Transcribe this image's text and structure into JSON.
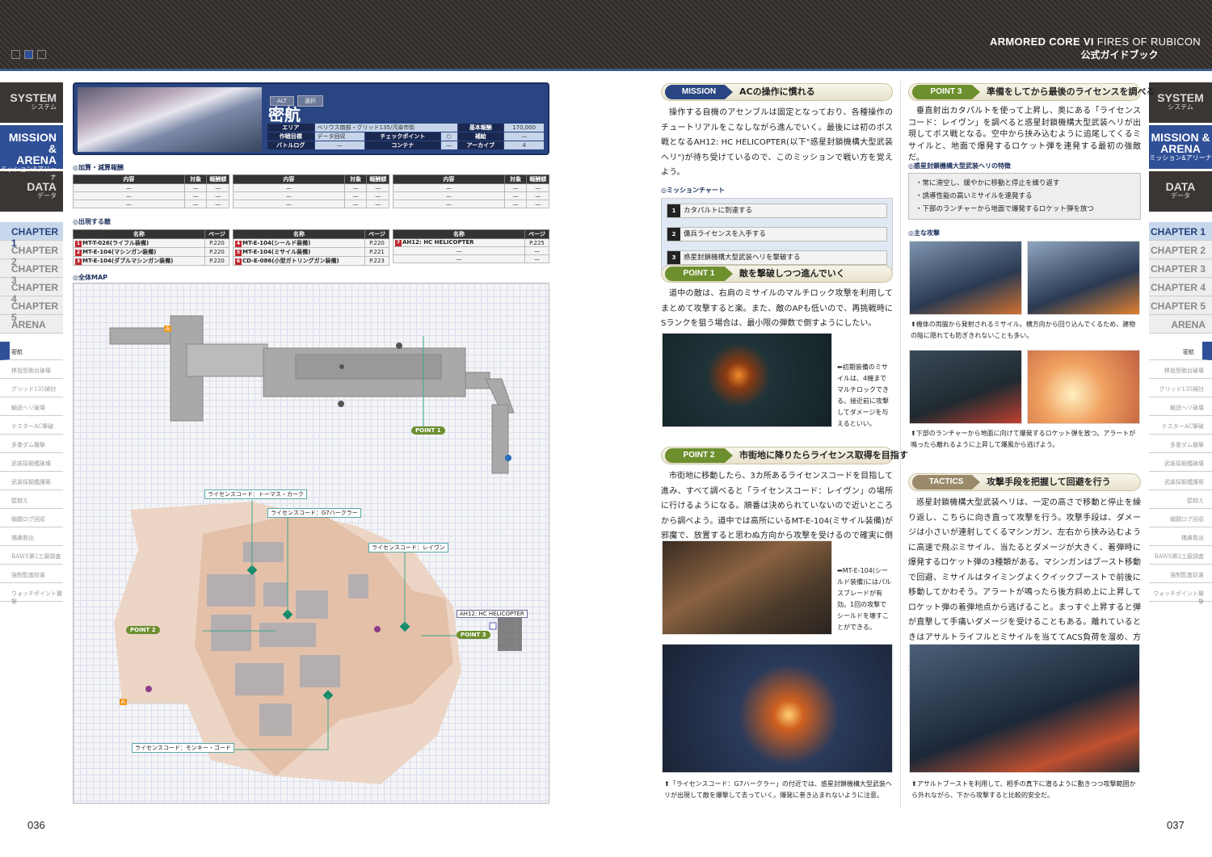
{
  "header": {
    "brand_bold": "ARMORED CORE VI",
    "brand_light": "FIRES OF RUBICON",
    "subtitle": "公式ガイドブック"
  },
  "colors": {
    "accent": "#2f4f97",
    "header_bg": "#3a3634",
    "point_green": "#6d8f2e",
    "enemy_red": "#c0262d"
  },
  "sidebar": {
    "tabs": [
      {
        "label": "SYSTEM",
        "sub": "システム"
      },
      {
        "label": "MISSION &",
        "label2": "ARENA",
        "sub": "ミッション&アリーナ"
      },
      {
        "label": "DATA",
        "sub": "データ"
      }
    ],
    "chapters": [
      "CHAPTER 1",
      "CHAPTER 2",
      "CHAPTER 3",
      "CHAPTER 4",
      "CHAPTER 5",
      "ARENA"
    ],
    "missions": [
      "密航",
      "移設型砲台破壊",
      "グリッド135掃討",
      "輸送ヘリ破壊",
      "テスターAC撃破",
      "多重ダム襲撃",
      "武装採掘艦破壊",
      "武装採掘艦護衛",
      "壁越え",
      "戦闘ログ回収",
      "捕虜救出",
      "BAWS第2工廠調査",
      "強制監査妨害",
      "ウォッチポイント襲撃"
    ]
  },
  "mission": {
    "tags": [
      "ALT",
      "選択"
    ],
    "title": "密航",
    "info": {
      "area_k": "エリア",
      "area_v": "ベリウス南部・グリッド135/汚染市街",
      "reward_k": "基本報酬",
      "reward_v": "170,000",
      "goal_k": "作戦目標",
      "goal_v": "データ回収",
      "cp_k": "チェックポイント",
      "cp_v": "○",
      "supply_k": "補給",
      "supply_v": "—",
      "log_k": "バトルログ",
      "log_v": "—",
      "cont_k": "コンテナ",
      "cont_v": "—",
      "arch_k": "アーカイブ",
      "arch_v": "4"
    }
  },
  "rewards": {
    "title": "加算・減算報酬",
    "headers": [
      "内容",
      "対象",
      "報酬額"
    ],
    "dash": "—"
  },
  "enemies": {
    "title": "出現する敵",
    "headers": [
      "名称",
      "ページ"
    ],
    "cols": [
      [
        {
          "n": "1",
          "name": "MT-T-026(ライフル装備)",
          "page": "P.220"
        },
        {
          "n": "2",
          "name": "MT-E-104(マシンガン装備)",
          "page": "P.220"
        },
        {
          "n": "3",
          "name": "MT-E-104(ダブルマシンガン装備)",
          "page": "P.220"
        }
      ],
      [
        {
          "n": "4",
          "name": "MT-E-104(シールド装備)",
          "page": "P.220"
        },
        {
          "n": "5",
          "name": "MT-E-104(ミサイル装備)",
          "page": "P.221"
        },
        {
          "n": "6",
          "name": "CD-E-086(小型ガトリングガン装備)",
          "page": "P.223"
        }
      ],
      [
        {
          "n": "7",
          "name": "AH12: HC HELICOPTER",
          "page": "P.225"
        },
        {
          "n": "",
          "name": "—",
          "page": "—"
        },
        {
          "n": "",
          "name": "—",
          "page": "—"
        }
      ]
    ]
  },
  "map": {
    "title": "全体MAP",
    "point1": "POINT 1",
    "point2": "POINT 2",
    "point3": "POINT 3",
    "start": "A",
    "labels": {
      "thomas": "ライセンスコード：トーマス・カーク",
      "g7": "ライセンスコード：G7ハークラー",
      "raven": "ライセンスコード：レイヴン",
      "monkey": "ライセンスコード：モンキー・ゴード",
      "heli": "AH12: HC HELICOPTER"
    }
  },
  "right": {
    "mission_banner": {
      "tag": "MISSION",
      "title": "ACの操作に慣れる"
    },
    "mission_text": "操作する自機のアセンブルは固定となっており、各種操作のチュートリアルをこなしながら進んでいく。最後には初のボス戦となるAH12: HC HELICOPTER(以下\"惑星封鎖機構大型武装ヘリ\")が待ち受けているので、このミッションで戦い方を覚えよう。",
    "chart_title": "ミッションチャート",
    "steps": [
      "カタパルトに到達する",
      "傭兵ライセンスを入手する",
      "惑星封鎖機構大型武装ヘリを撃破する"
    ],
    "p1": {
      "tag": "POINT 1",
      "title": "敵を撃破しつつ進んでいく",
      "text": "道中の敵は、右肩のミサイルのマルチロック攻撃を利用してまとめて攻撃すると楽。また、敵のAPも低いので、再挑戦時にSランクを狙う場合は、最小限の弾数で倒すようにしたい。",
      "cap": "⬅初期装備のミサイルは、4機までマルチロックできる。接近前に攻撃してダメージを与えるといい。"
    },
    "p2": {
      "tag": "POINT 2",
      "title": "市街地に降りたらライセンス取得を目指す",
      "text": "市街地に移動したら、3カ所あるライセンスコードを目指して進み、すべて調べると「ライセンスコード：レイヴン」の場所に行けるようになる。順番は決められていないので近いところから調べよう。道中では高所にいるMT-E-104(ミサイル装備)が邪魔で、放置すると思わぬ方向から攻撃を受けるので確実に倒そう。",
      "cap": "⬅MT-E-104(シールド装備)にはパルスブレードが有効。1回の攻撃でシールドを壊すことができる。",
      "cap2": "⬆「ライセンスコード：G7ハークラー」の付近では、惑星封鎖機構大型武装ヘリが出現して敵を爆撃して去っていく。爆発に巻き込まれないように注意。"
    },
    "p3": {
      "tag": "POINT 3",
      "title": "準備をしてから最後のライセンスを調べる",
      "text": "垂直射出カタパルトを使って上昇し、奥にある「ライセンスコード：レイヴン」を調べると惑星封鎖機構大型武装ヘリが出現してボス戦となる。空中から挟み込むように追尾してくるミサイルと、地面で爆発するロケット弾を連発する最初の強敵だ。"
    },
    "features_title": "惑星封鎖機構大型武装ヘリの特徴",
    "features": [
      "・常に滞空し、緩やかに移動と停止を繰り返す",
      "・誘導性能の高いミサイルを連発する",
      "・下部のランチャーから地面で爆発するロケット弾を放つ"
    ],
    "attacks_title": "主な攻撃",
    "attack_caps": [
      "⬆機体の両脇から発射されるミサイル。横方向から回り込んでくるため、建物の陰に隠れても防ぎきれないことも多い。",
      "⬆下部のランチャーから地面に向けて爆発するロケット弾を放つ。アラートが鳴ったら離れるように上昇して爆風から逃げよう。"
    ],
    "tactics": {
      "tag": "TACTICS",
      "title": "攻撃手段を把握して回避を行う",
      "text": "惑星封鎖機構大型武装ヘリは、一定の高さで移動と停止を繰り返し、こちらに向き直って攻撃を行う。攻撃手段は、ダメージは小さいが連射してくるマシンガン、左右から挟み込むように高速で飛ぶミサイル、当たるとダメージが大きく、着弾時に爆発するロケット弾の3種類がある。マシンガンはブースト移動で回避、ミサイルはタイミングよくクイックブーストで前後に移動してかわそう。アラートが鳴ったら後方斜め上に上昇してロケット弾の着弾地点から逃げること。まっすぐ上昇すると弾が直撃して手痛いダメージを受けることもある。離れているときはアサルトライフルとミサイルを当ててACS負荷を溜め、方向転換で動きが止まったところにアサルトブーストで接近して近接攻撃を狙おう。",
      "cap": "⬆アサルトブーストを利用して、相手の真下に潜るように動きつつ攻撃範囲から外れながら、下から攻撃すると比較的安全だ。"
    }
  },
  "pages": {
    "left": "036",
    "right": "037"
  }
}
